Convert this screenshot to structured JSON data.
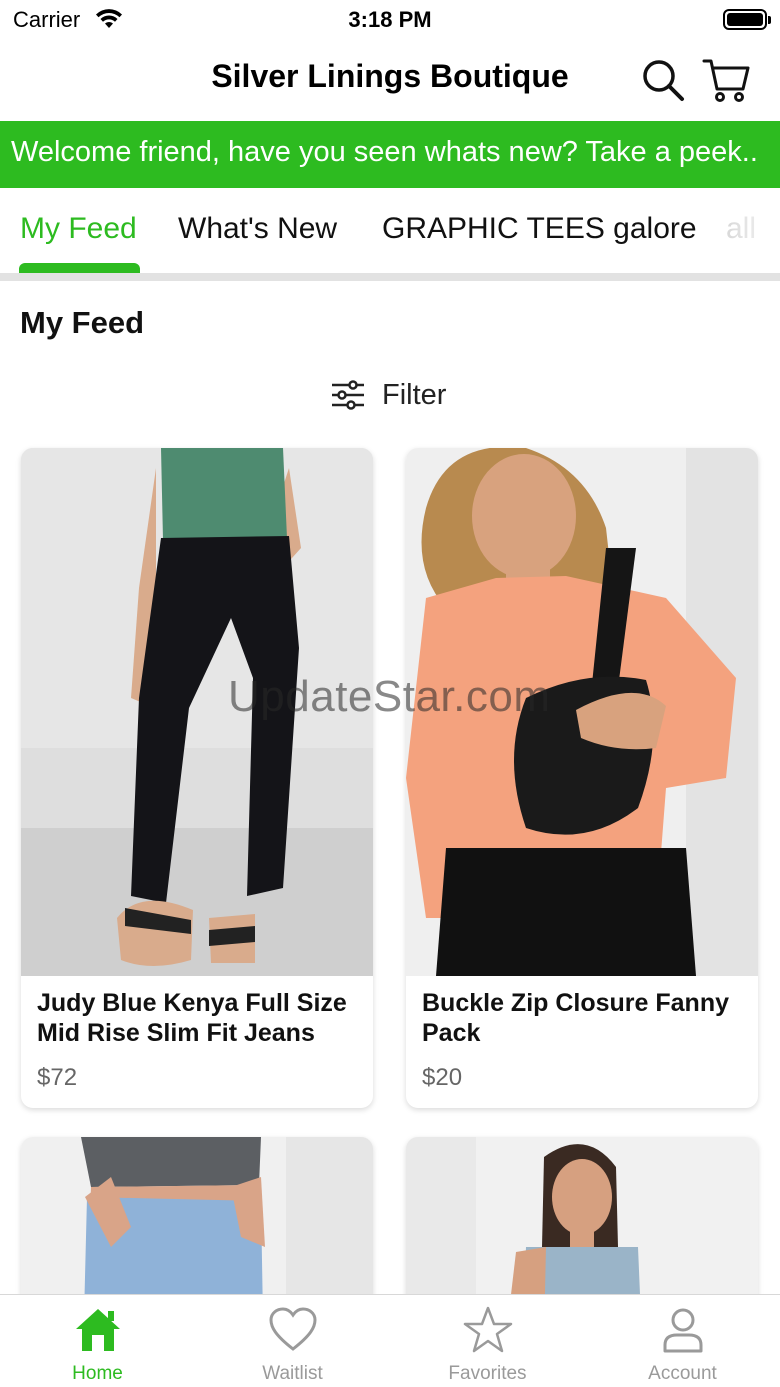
{
  "status_bar": {
    "carrier": "Carrier",
    "time": "3:18 PM"
  },
  "header": {
    "title": "Silver Linings Boutique",
    "search_icon": "search-icon",
    "cart_icon": "cart-icon"
  },
  "banner": {
    "text": "Welcome friend, have you seen whats new? Take a peek.."
  },
  "tabs": [
    {
      "label": "My Feed",
      "active": true
    },
    {
      "label": "What's New",
      "active": false
    },
    {
      "label": "GRAPHIC TEES galore",
      "active": false
    },
    {
      "label": "all",
      "active": false
    }
  ],
  "feed": {
    "title": "My Feed",
    "filter_label": "Filter"
  },
  "products": [
    {
      "name": "Judy Blue Kenya Full Size Mid Rise Slim Fit Jeans",
      "price": "$72"
    },
    {
      "name": "Buckle Zip Closure Fanny Pack",
      "price": "$20"
    },
    {
      "name": "",
      "price": ""
    },
    {
      "name": "",
      "price": ""
    }
  ],
  "watermark": "UpdateStar.com",
  "tabbar": [
    {
      "label": "Home",
      "icon": "home-icon",
      "active": true
    },
    {
      "label": "Waitlist",
      "icon": "heart-icon",
      "active": false
    },
    {
      "label": "Favorites",
      "icon": "star-icon",
      "active": false
    },
    {
      "label": "Account",
      "icon": "person-icon",
      "active": false
    }
  ],
  "colors": {
    "accent": "#2dbb20",
    "inactive": "#9a9a9a"
  }
}
